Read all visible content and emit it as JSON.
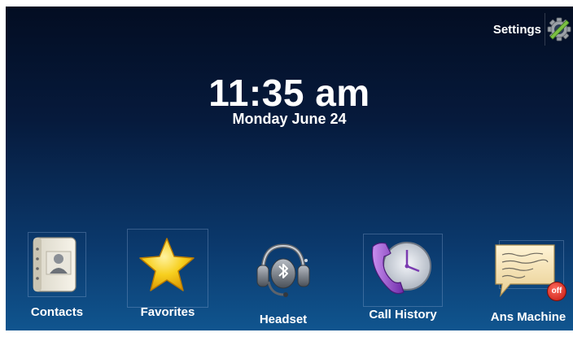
{
  "status": {
    "settings_label": "Settings",
    "settings_icon": "gear-icon"
  },
  "clock": {
    "time": "11:35 am",
    "date": "Monday June 24"
  },
  "apps": {
    "contacts": {
      "label": "Contacts",
      "icon": "address-book-icon"
    },
    "favorites": {
      "label": "Favorites",
      "icon": "star-icon"
    },
    "headset": {
      "label": "Headset",
      "icon": "bluetooth-headset-icon"
    },
    "call_history": {
      "label": "Call History",
      "icon": "phone-clock-icon"
    },
    "ans_machine": {
      "label": "Ans Machine",
      "icon": "message-note-icon",
      "badge": "off"
    }
  },
  "colors": {
    "background_top": "#030d22",
    "background_bottom": "#10558f",
    "star": "#f5c000",
    "phone": "#8e44c8",
    "badge": "#d9251d"
  }
}
